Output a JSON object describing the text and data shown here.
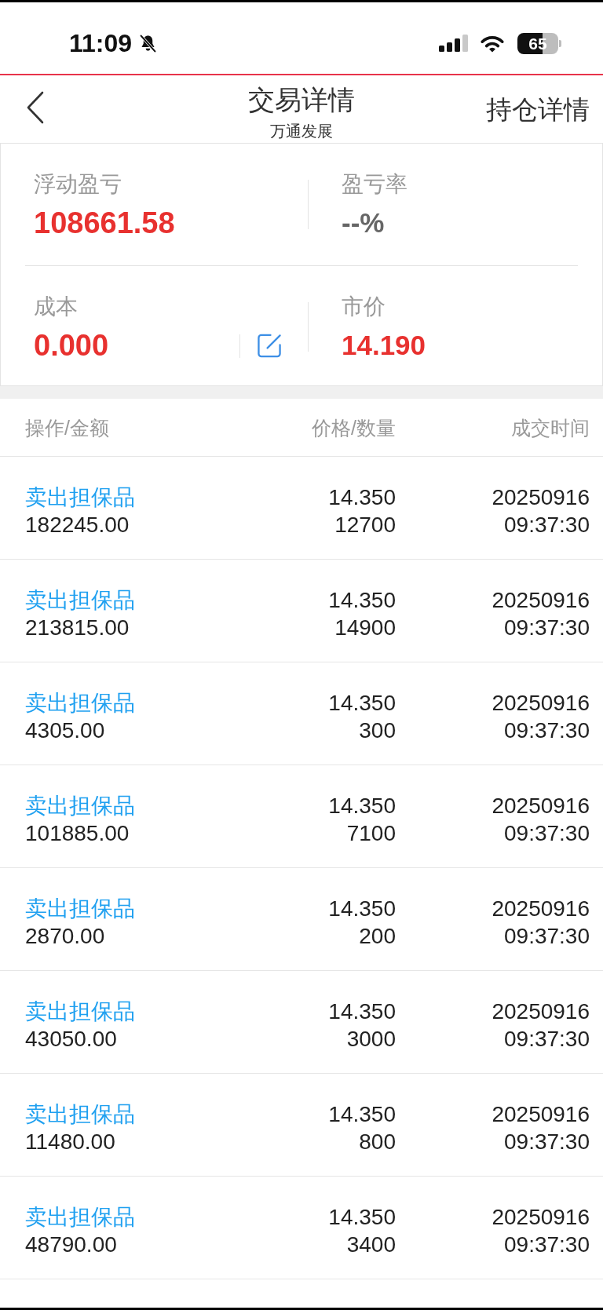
{
  "status_bar": {
    "time": "11:09",
    "battery": "65"
  },
  "nav": {
    "title": "交易详情",
    "subtitle": "万通发展",
    "action": "持仓详情"
  },
  "summary": [
    {
      "label": "浮动盈亏",
      "value": "108661.58",
      "color": "#e8312f",
      "editable": false
    },
    {
      "label": "盈亏率",
      "value": "--%",
      "color": "#666666",
      "editable": false
    },
    {
      "label": "成本",
      "value": "0.000",
      "color": "#e8312f",
      "editable": true
    },
    {
      "label": "市价",
      "value": "14.190",
      "color": "#e8312f",
      "editable": false
    }
  ],
  "table": {
    "columns": [
      "操作/金额",
      "价格/数量",
      "成交时间"
    ],
    "rows": [
      {
        "type": "卖出担保品",
        "amount": "182245.00",
        "price": "14.350",
        "quantity": "12700",
        "date": "20250916",
        "time": "09:37:30"
      },
      {
        "type": "卖出担保品",
        "amount": "213815.00",
        "price": "14.350",
        "quantity": "14900",
        "date": "20250916",
        "time": "09:37:30"
      },
      {
        "type": "卖出担保品",
        "amount": "4305.00",
        "price": "14.350",
        "quantity": "300",
        "date": "20250916",
        "time": "09:37:30"
      },
      {
        "type": "卖出担保品",
        "amount": "101885.00",
        "price": "14.350",
        "quantity": "7100",
        "date": "20250916",
        "time": "09:37:30"
      },
      {
        "type": "卖出担保品",
        "amount": "2870.00",
        "price": "14.350",
        "quantity": "200",
        "date": "20250916",
        "time": "09:37:30"
      },
      {
        "type": "卖出担保品",
        "amount": "43050.00",
        "price": "14.350",
        "quantity": "3000",
        "date": "20250916",
        "time": "09:37:30"
      },
      {
        "type": "卖出担保品",
        "amount": "11480.00",
        "price": "14.350",
        "quantity": "800",
        "date": "20250916",
        "time": "09:37:30"
      },
      {
        "type": "卖出担保品",
        "amount": "48790.00",
        "price": "14.350",
        "quantity": "3400",
        "date": "20250916",
        "time": "09:37:30"
      }
    ]
  }
}
